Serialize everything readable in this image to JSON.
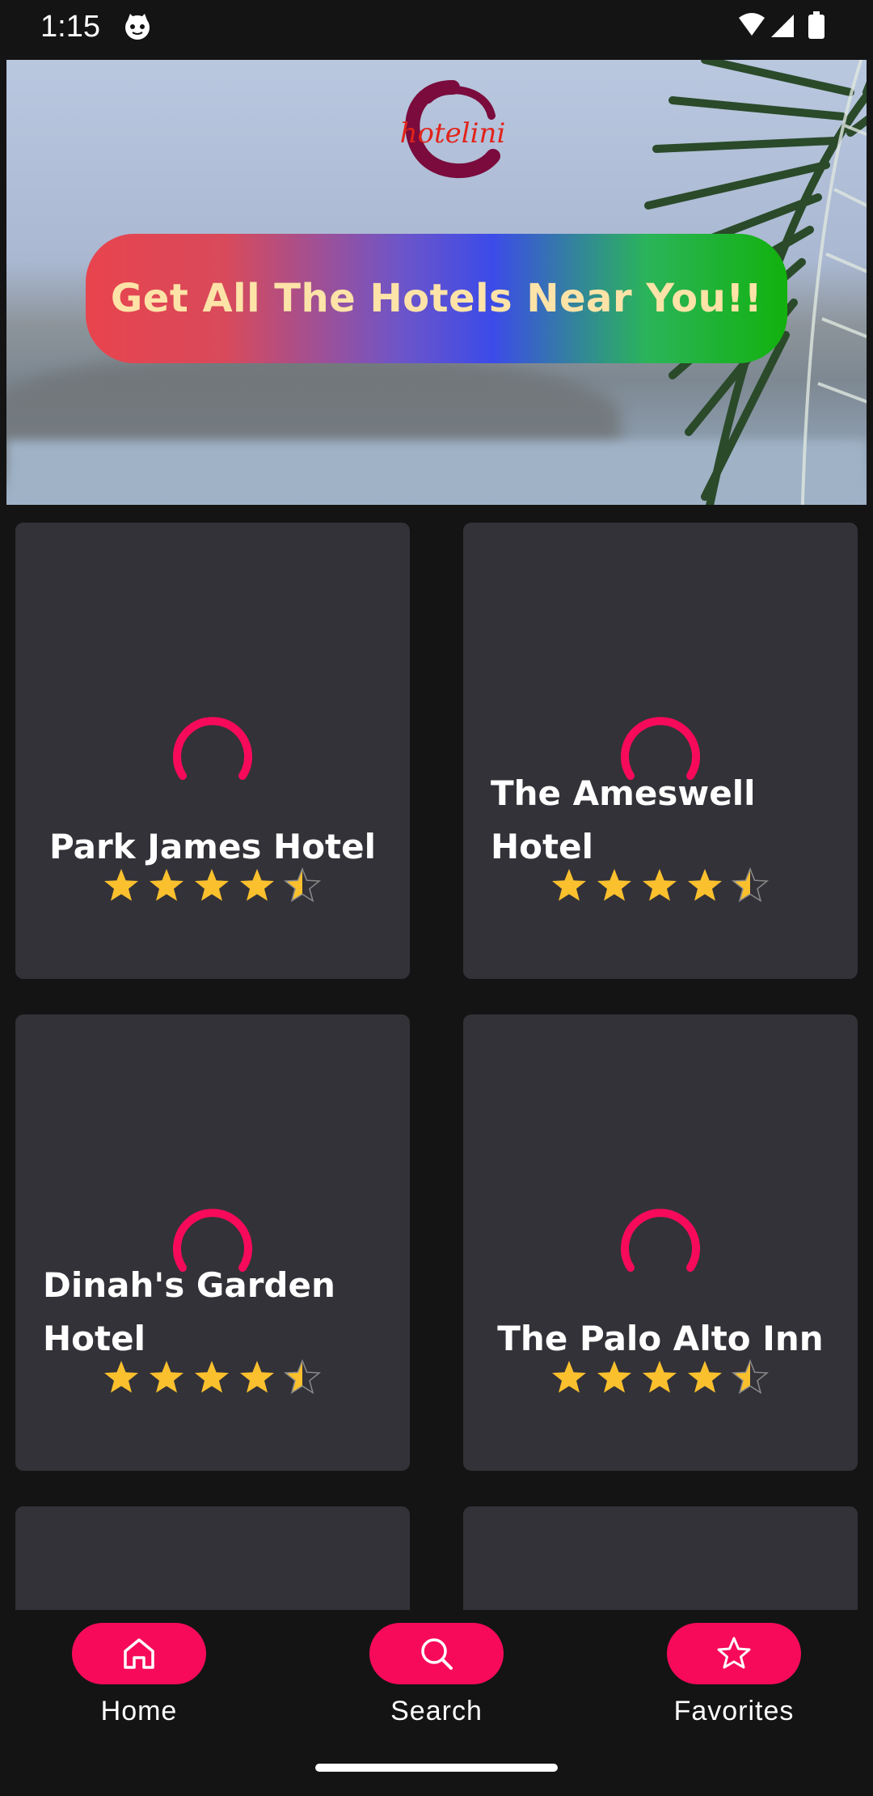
{
  "status_bar": {
    "time": "1:15"
  },
  "hero": {
    "logo_text": "hotelini",
    "button_label": "Get All The Hotels Near You!!"
  },
  "hotels": [
    {
      "name": "Park James Hotel",
      "rating": 4.5
    },
    {
      "name": "The Ameswell Hotel",
      "rating": 4.5
    },
    {
      "name": "Dinah's Garden Hotel",
      "rating": 4.5
    },
    {
      "name": "The Palo Alto Inn",
      "rating": 4.5
    }
  ],
  "bottom_nav": [
    {
      "label": "Home",
      "icon": "home-icon"
    },
    {
      "label": "Search",
      "icon": "search-icon"
    },
    {
      "label": "Favorites",
      "icon": "star-icon"
    }
  ],
  "colors": {
    "accent": "#f70a5a",
    "card": "#333238",
    "background": "#141414",
    "star": "#fbc02d"
  }
}
